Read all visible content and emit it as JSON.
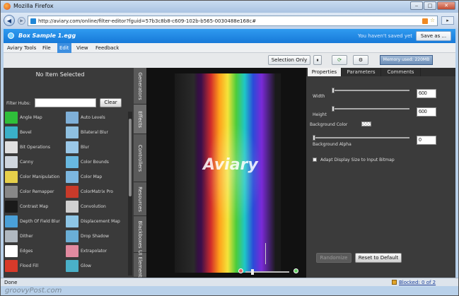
{
  "window": {
    "title": "Mozilla Firefox",
    "buttons": [
      "‒",
      "□",
      "✕"
    ]
  },
  "nav": {
    "url": "http://aviary.com/online/filter-editor?fguid=57b3c8b8-c609-102b-b565-0030488e168c#"
  },
  "app": {
    "document_title": "Box Sample 1.egg",
    "unsaved_text": "You haven't saved yet",
    "save_as": "Save as ..."
  },
  "menu": {
    "items": [
      "Aviary Tools",
      "File",
      "Edit",
      "View",
      "Feedback"
    ],
    "active": "Edit"
  },
  "toolbar": {
    "selection_only": "Selection Only",
    "pause_icon": "pause-icon",
    "memory": "Memory used: 220MB"
  },
  "left_panel": {
    "heading": "No Item Selected",
    "filter_hubs_label": "Filter Hubs:",
    "filter_hubs_value": "",
    "clear_label": "Clear",
    "filters": [
      {
        "label": "Angle Map",
        "color": "#2fbf3a"
      },
      {
        "label": "Auto Levels",
        "color": "#7fb0d8"
      },
      {
        "label": "Bevel",
        "color": "#3ab0c8"
      },
      {
        "label": "Bilateral Blur",
        "color": "#8fc0e0"
      },
      {
        "label": "Bit Operations",
        "color": "#e0e0e0"
      },
      {
        "label": "Blur",
        "color": "#9ac8e8"
      },
      {
        "label": "Canny",
        "color": "#cfd6de"
      },
      {
        "label": "Color Bounds",
        "color": "#68b8e0"
      },
      {
        "label": "Color Manipulation",
        "color": "#e6d04a"
      },
      {
        "label": "Color Map",
        "color": "#7cb7e0"
      },
      {
        "label": "Color Remapper",
        "color": "#888888"
      },
      {
        "label": "ColorMatrix Pro",
        "color": "#c83a2a"
      },
      {
        "label": "Contrast Map",
        "color": "#1a1a1a"
      },
      {
        "label": "Convolution",
        "color": "#d0d0d0"
      },
      {
        "label": "Depth Of Field Blur",
        "color": "#4aa0d8"
      },
      {
        "label": "Displacement Map",
        "color": "#8ec6e6"
      },
      {
        "label": "Dither",
        "color": "#b0b8c0"
      },
      {
        "label": "Drop Shadow",
        "color": "#6aaed6"
      },
      {
        "label": "Edges",
        "color": "#ffffff"
      },
      {
        "label": "Extrapolator",
        "color": "#e28aa0"
      },
      {
        "label": "Flood Fill",
        "color": "#d83a2a"
      },
      {
        "label": "Glow",
        "color": "#4ab0c8"
      }
    ]
  },
  "side_tabs": [
    "Generators",
    "Effects",
    "Controllers",
    "Resources",
    "Blackboxes",
    "UI Elements"
  ],
  "canvas": {
    "watermark_word": "Aviary"
  },
  "right_panel": {
    "tabs": [
      "Properties",
      "Parameters",
      "Comments"
    ],
    "active_tab": "Properties",
    "width_label": "Width",
    "width_value": "600",
    "height_label": "Height",
    "height_value": "600",
    "bg_color_label": "Background Color",
    "bg_alpha_label": "Background Alpha",
    "bg_alpha_value": "0",
    "adapt_label": "Adapt Display Size to Input Bitmap",
    "randomize": "Randomize",
    "reset": "Reset to Default"
  },
  "status": {
    "text": "Done",
    "blocked": "Blocked: 0 of 2"
  },
  "watermark": "groovyPost.com"
}
